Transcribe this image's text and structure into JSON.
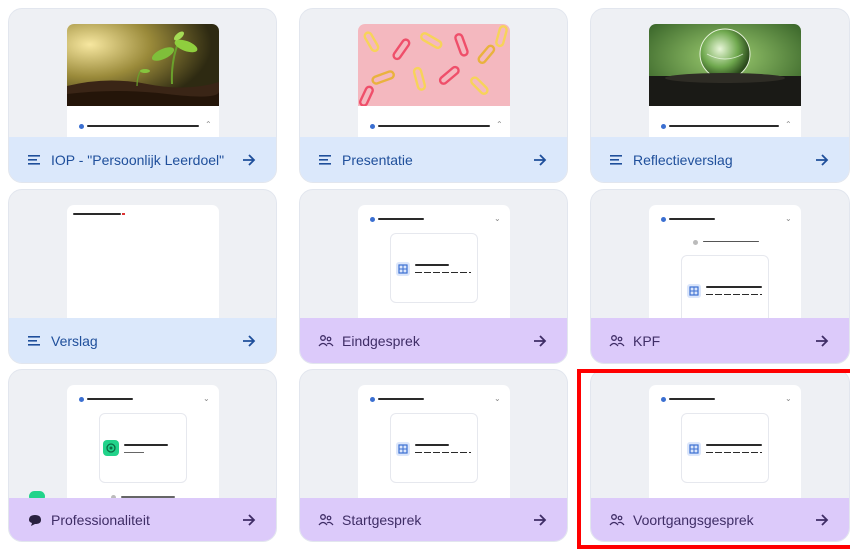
{
  "cards": [
    {
      "title": "IOP - \"Persoonlijk Leerdoel\"",
      "type": "document",
      "preview": "sprout"
    },
    {
      "title": "Presentatie",
      "type": "document",
      "preview": "paperclips"
    },
    {
      "title": "Reflectieverslag",
      "type": "document",
      "preview": "glass-sphere"
    },
    {
      "title": "Verslag",
      "type": "document",
      "preview": "blank"
    },
    {
      "title": "Eindgesprek",
      "type": "conversation",
      "preview": "table"
    },
    {
      "title": "KPF",
      "type": "conversation",
      "preview": "table-list"
    },
    {
      "title": "Professionaliteit",
      "type": "comment",
      "preview": "badge"
    },
    {
      "title": "Startgesprek",
      "type": "conversation",
      "preview": "table"
    },
    {
      "title": "Voortgangsgesprek",
      "type": "conversation",
      "preview": "table"
    }
  ],
  "icons": {
    "document": "lines-icon",
    "conversation": "people-icon",
    "comment": "speech-bubble-icon",
    "arrow": "arrow-right-icon"
  },
  "colors": {
    "card_bg": "#eef0f4",
    "footer_blue": "#dbe8fb",
    "footer_purple": "#dccafa",
    "accent_blue": "#3b6fd1",
    "badge_green": "#22d38a",
    "selection_red": "#ff0000"
  }
}
